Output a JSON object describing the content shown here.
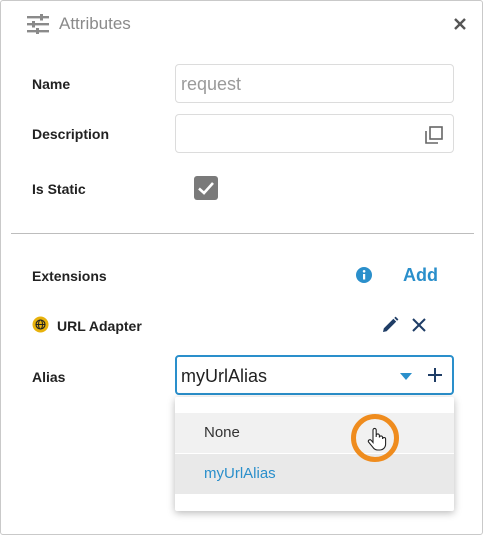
{
  "header": {
    "title": "Attributes",
    "icon": "sliders-icon",
    "close_icon": "close-icon"
  },
  "form": {
    "name_label": "Name",
    "name_value": "request",
    "description_label": "Description",
    "description_value": "",
    "is_static_label": "Is Static",
    "is_static_checked": true
  },
  "extensions": {
    "label": "Extensions",
    "add_label": "Add",
    "info_icon": "info-icon",
    "item": {
      "label": "URL Adapter",
      "icon": "globe-icon"
    }
  },
  "alias": {
    "label": "Alias",
    "selected": "myUrlAlias",
    "options": [
      "None",
      "myUrlAlias"
    ]
  },
  "colors": {
    "accent": "#2a8fcb",
    "cursor_highlight": "#ef8c1e",
    "globe": "#e8b20c"
  }
}
